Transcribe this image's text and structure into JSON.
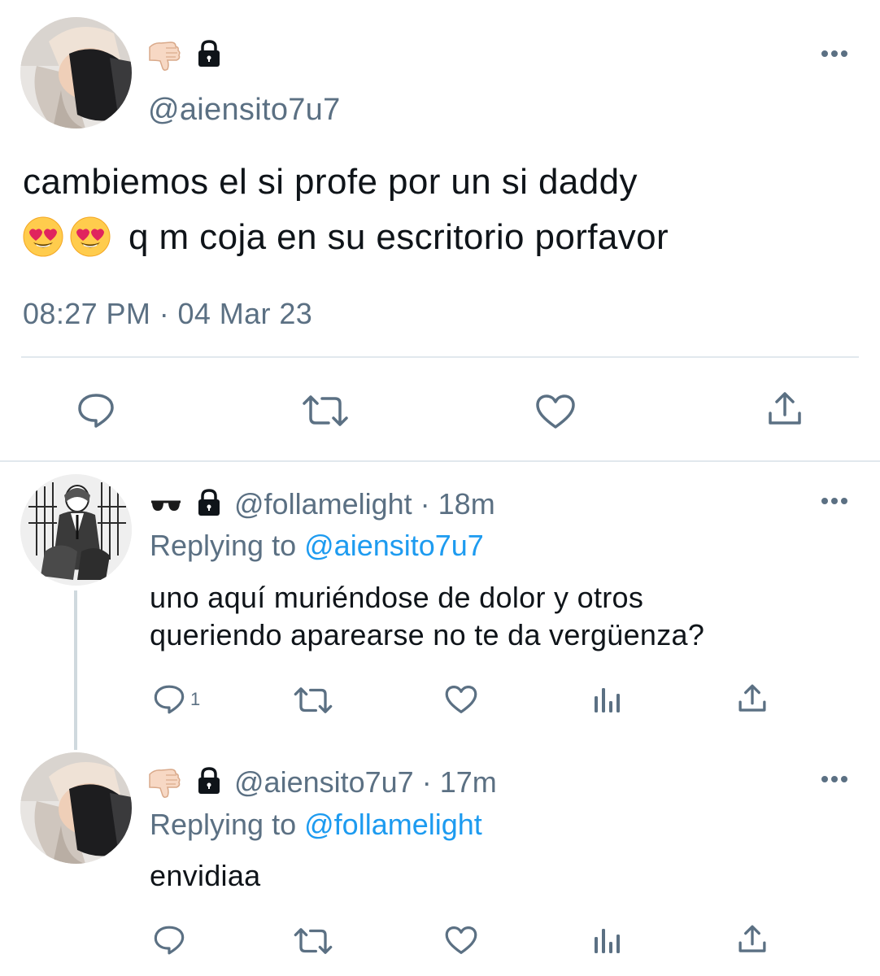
{
  "main_tweet": {
    "emojis": [
      "thumbs-down-icon",
      "lock-icon"
    ],
    "handle": "@aiensito7u7",
    "text_line1": "cambiemos el si profe por un si daddy",
    "text_line2": "q m coja en su escritorio porfavor",
    "inline_emojis": [
      "heart-eyes-emoji",
      "heart-eyes-emoji"
    ],
    "timestamp": "08:27 PM · 04 Mar 23",
    "actions": [
      "reply-icon",
      "retweet-icon",
      "like-icon",
      "share-icon"
    ]
  },
  "replies": [
    {
      "emojis": [
        "sunglasses-icon",
        "lock-icon"
      ],
      "handle": "@follamelight",
      "time": "· 18m",
      "replying_label": "Replying to",
      "replying_to": "@aiensito7u7",
      "text_line1": "uno aquí muriéndose de dolor y otros",
      "text_line2": "queriendo aparearse no te da vergüenza?",
      "reply_count": "1",
      "actions": [
        "reply-icon",
        "retweet-icon",
        "like-icon",
        "stats-icon",
        "share-icon"
      ]
    },
    {
      "emojis": [
        "thumbs-down-icon",
        "lock-icon"
      ],
      "handle": "@aiensito7u7",
      "time": "· 17m",
      "replying_label": "Replying to",
      "replying_to": "@follamelight",
      "text_line1": "envidiaa",
      "actions": [
        "reply-icon",
        "retweet-icon",
        "like-icon",
        "stats-icon",
        "share-icon"
      ]
    }
  ],
  "colors": {
    "text": "#0f1419",
    "muted": "#5b7083",
    "link": "#1d9bf0",
    "divider": "#e1e8ed"
  }
}
